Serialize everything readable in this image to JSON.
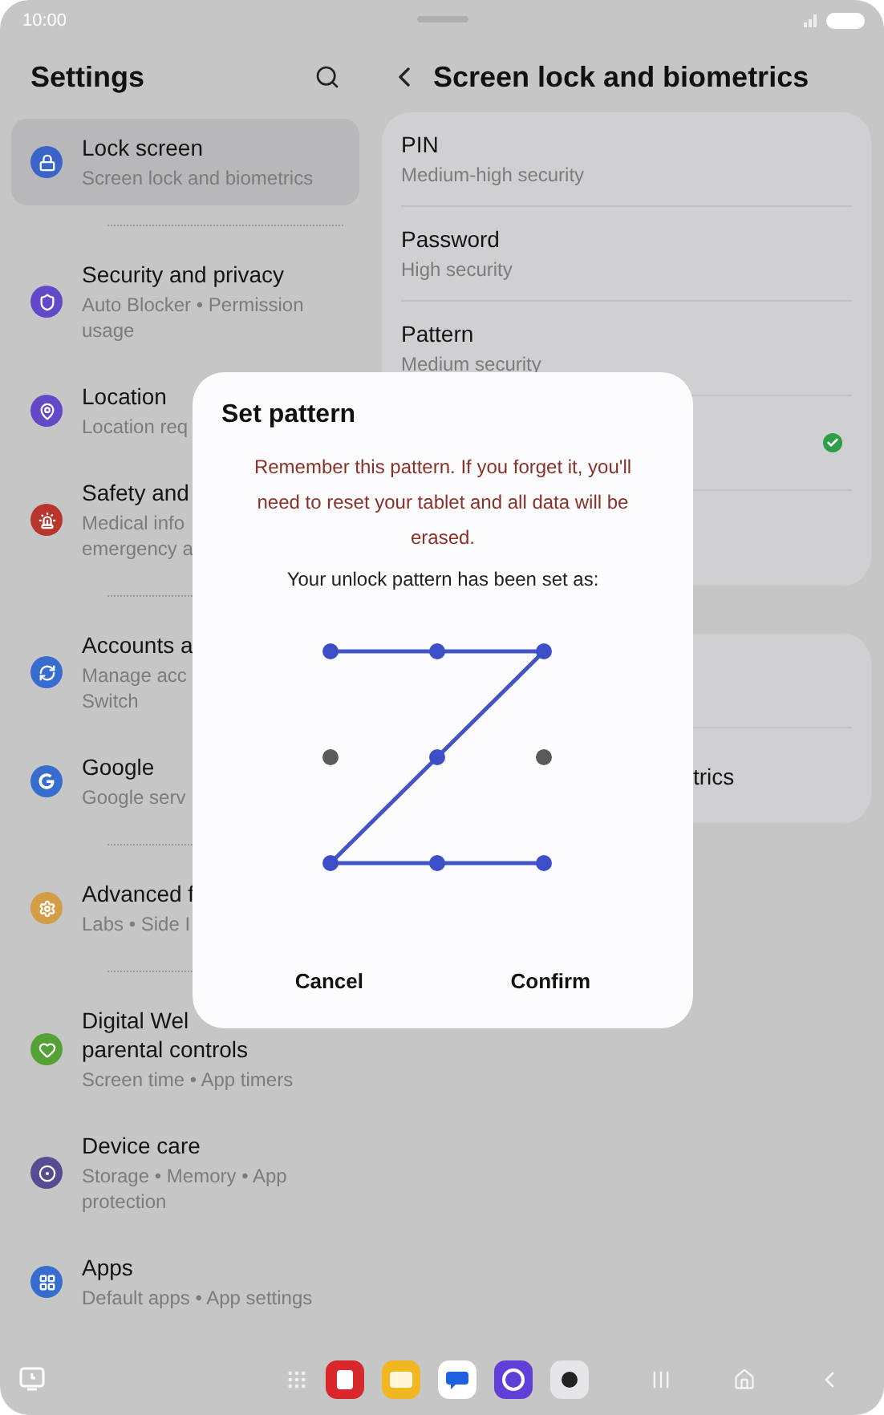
{
  "status_bar": {
    "time": "10:00"
  },
  "settings": {
    "title": "Settings",
    "groups": [
      [
        {
          "title": "Lock screen",
          "subtitle": "Screen lock and biometrics",
          "color": "#3b64c9",
          "selected": true
        }
      ],
      [
        {
          "title": "Security and privacy",
          "subtitle": "Auto Blocker  •  Permission usage",
          "color": "#6249c9",
          "selected": false
        },
        {
          "title": "Location",
          "subtitle": "Location req",
          "color": "#6249c9",
          "selected": false
        },
        {
          "title": "Safety and",
          "subtitle": "Medical info\nemergency a",
          "color": "#b8362c",
          "selected": false
        }
      ],
      [
        {
          "title": "Accounts a",
          "subtitle": "Manage acc\nSwitch",
          "color": "#386dd0",
          "selected": false
        },
        {
          "title": "Google",
          "subtitle": "Google serv",
          "color": "#386dd0",
          "selected": false
        }
      ],
      [
        {
          "title": "Advanced f",
          "subtitle": "Labs  •  Side I",
          "color": "#d29d45",
          "selected": false
        }
      ],
      [
        {
          "title": "Digital Wel\nparental controls",
          "subtitle": "Screen time  •  App timers",
          "color": "#54a236",
          "selected": false
        },
        {
          "title": "Device care",
          "subtitle": "Storage  •  Memory  •  App protection",
          "color": "#574c92",
          "selected": false
        },
        {
          "title": "Apps",
          "subtitle": "Default apps  •  App settings",
          "color": "#386dd0",
          "selected": false
        }
      ]
    ]
  },
  "detail": {
    "title": "Screen lock and biometrics",
    "cards": [
      [
        {
          "title": "PIN",
          "subtitle": "Medium-high security",
          "checked": false
        },
        {
          "title": "Password",
          "subtitle": "High security",
          "checked": false
        },
        {
          "title": "Pattern",
          "subtitle": "Medium security",
          "checked": false
        },
        {
          "checked": true
        },
        {
          "checked": false
        }
      ],
      [
        {
          "checked": false
        },
        {
          "title": "trics",
          "checked": false
        }
      ]
    ]
  },
  "dialog": {
    "title": "Set pattern",
    "warning": "Remember this pattern. If you forget it, you'll need to reset your tablet and all data will be erased.",
    "message": "Your unlock pattern has been set as:",
    "pattern_dots": [
      {
        "selected": true
      },
      {
        "selected": true
      },
      {
        "selected": true
      },
      {
        "selected": false
      },
      {
        "selected": true
      },
      {
        "selected": false
      },
      {
        "selected": true
      },
      {
        "selected": true
      },
      {
        "selected": true
      }
    ],
    "buttons": [
      "Cancel",
      "Confirm"
    ]
  }
}
